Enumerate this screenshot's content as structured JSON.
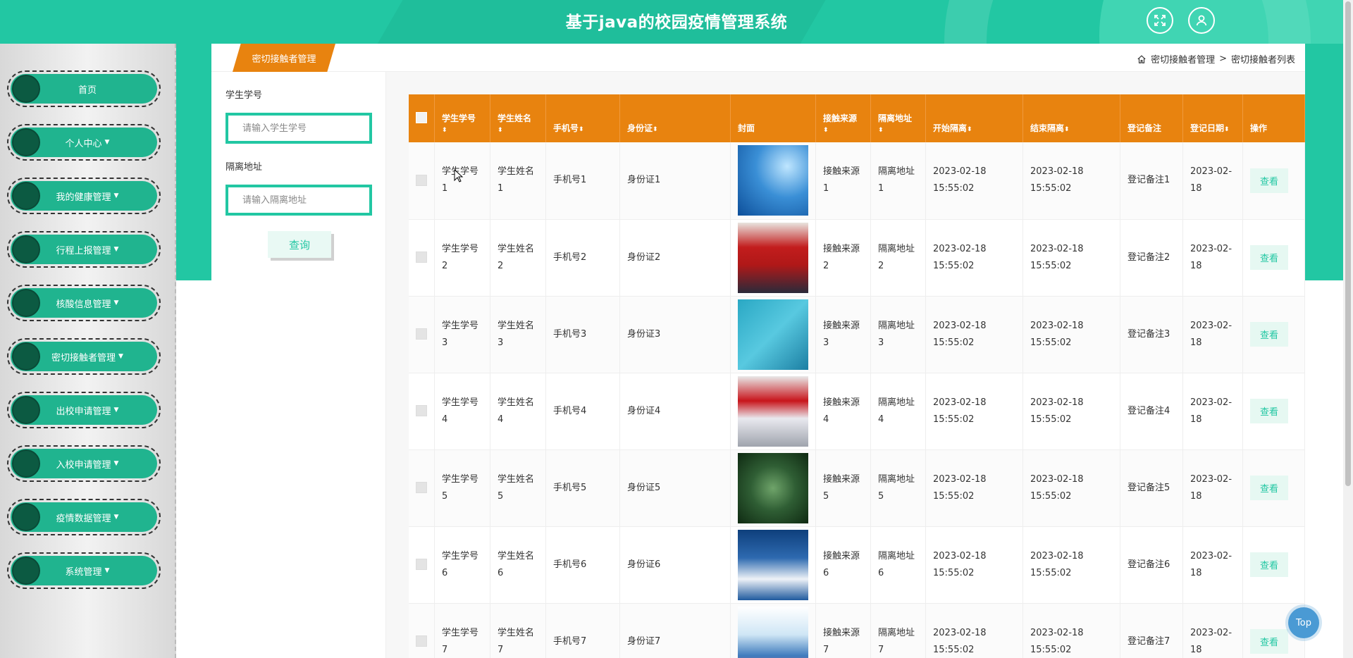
{
  "header": {
    "title": "基于java的校园疫情管理系统"
  },
  "sidebar": {
    "items": [
      {
        "label": "首页",
        "caret": false
      },
      {
        "label": "个人中心",
        "caret": true
      },
      {
        "label": "我的健康管理",
        "caret": true
      },
      {
        "label": "行程上报管理",
        "caret": true
      },
      {
        "label": "核酸信息管理",
        "caret": true
      },
      {
        "label": "密切接触者管理",
        "caret": true
      },
      {
        "label": "出校申请管理",
        "caret": true
      },
      {
        "label": "入校申请管理",
        "caret": true
      },
      {
        "label": "疫情数据管理",
        "caret": true
      },
      {
        "label": "系统管理",
        "caret": true
      }
    ]
  },
  "tab": {
    "active_label": "密切接触者管理"
  },
  "breadcrumb": {
    "level1": "密切接触者管理",
    "separator": ">",
    "level2": "密切接触者列表"
  },
  "search": {
    "field1_label": "学生学号",
    "field1_placeholder": "请输入学生学号",
    "field2_label": "隔离地址",
    "field2_placeholder": "请输入隔离地址",
    "query_label": "查询"
  },
  "table": {
    "headers": [
      "学生学号",
      "学生姓名",
      "手机号",
      "身份证",
      "封面",
      "接触来源",
      "隔离地址",
      "开始隔离",
      "结束隔离",
      "登记备注",
      "登记日期",
      "操作"
    ],
    "sort_glyph": "⬍",
    "view_label": "查看",
    "rows": [
      {
        "student_no": "学生学号1",
        "student_name": "学生姓名1",
        "phone": "手机号1",
        "id_card": "身份证1",
        "source": "接触来源1",
        "address": "隔离地址1",
        "start": "2023-02-18 15:55:02",
        "end": "2023-02-18 15:55:02",
        "remark": "登记备注1",
        "date": "2023-02-18"
      },
      {
        "student_no": "学生学号2",
        "student_name": "学生姓名2",
        "phone": "手机号2",
        "id_card": "身份证2",
        "source": "接触来源2",
        "address": "隔离地址2",
        "start": "2023-02-18 15:55:02",
        "end": "2023-02-18 15:55:02",
        "remark": "登记备注2",
        "date": "2023-02-18"
      },
      {
        "student_no": "学生学号3",
        "student_name": "学生姓名3",
        "phone": "手机号3",
        "id_card": "身份证3",
        "source": "接触来源3",
        "address": "隔离地址3",
        "start": "2023-02-18 15:55:02",
        "end": "2023-02-18 15:55:02",
        "remark": "登记备注3",
        "date": "2023-02-18"
      },
      {
        "student_no": "学生学号4",
        "student_name": "学生姓名4",
        "phone": "手机号4",
        "id_card": "身份证4",
        "source": "接触来源4",
        "address": "隔离地址4",
        "start": "2023-02-18 15:55:02",
        "end": "2023-02-18 15:55:02",
        "remark": "登记备注4",
        "date": "2023-02-18"
      },
      {
        "student_no": "学生学号5",
        "student_name": "学生姓名5",
        "phone": "手机号5",
        "id_card": "身份证5",
        "source": "接触来源5",
        "address": "隔离地址5",
        "start": "2023-02-18 15:55:02",
        "end": "2023-02-18 15:55:02",
        "remark": "登记备注5",
        "date": "2023-02-18"
      },
      {
        "student_no": "学生学号6",
        "student_name": "学生姓名6",
        "phone": "手机号6",
        "id_card": "身份证6",
        "source": "接触来源6",
        "address": "隔离地址6",
        "start": "2023-02-18 15:55:02",
        "end": "2023-02-18 15:55:02",
        "remark": "登记备注6",
        "date": "2023-02-18"
      },
      {
        "student_no": "学生学号7",
        "student_name": "学生姓名7",
        "phone": "手机号7",
        "id_card": "身份证7",
        "source": "接触来源7",
        "address": "隔离地址7",
        "start": "2023-02-18 15:55:02",
        "end": "2023-02-18 15:55:02",
        "remark": "登记备注7",
        "date": "2023-02-18"
      }
    ]
  },
  "top_button": {
    "label": "Top"
  },
  "colors": {
    "primary": "#22c7a3",
    "accent": "#e8830f",
    "menu": "#20b48f",
    "menu_dot": "#0c5a42"
  },
  "icons": {
    "fullscreen": "fullscreen-icon",
    "user": "user-icon",
    "home": "home-icon"
  }
}
